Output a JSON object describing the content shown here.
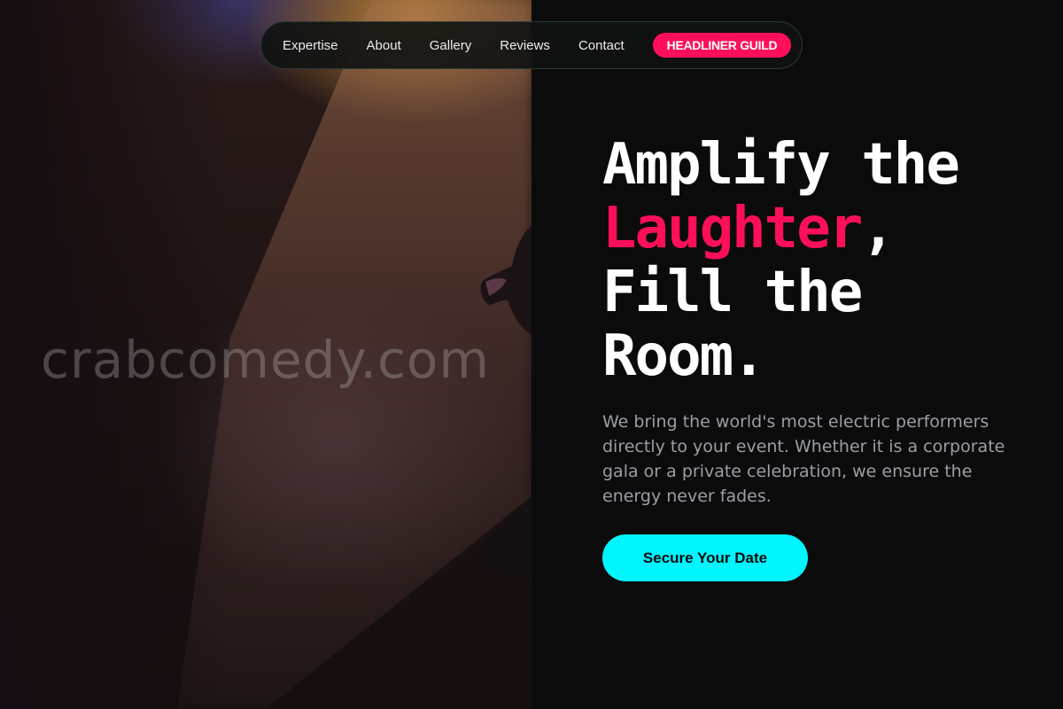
{
  "watermark": "crabcomedy.com",
  "nav": {
    "links": [
      "Expertise",
      "About",
      "Gallery",
      "Reviews",
      "Contact"
    ],
    "cta_label": "HEADLINER GUILD"
  },
  "hero": {
    "heading_line1": "Amplify the",
    "heading_accent": "Laughter",
    "heading_comma": ",",
    "heading_line3": "Fill the",
    "heading_line4": "Room.",
    "description": "We bring the world's most electric performers directly to your event. Whether it is a corporate gala or a private celebration, we ensure the energy never fades.",
    "cta_label": "Secure Your Date"
  },
  "colors": {
    "accent_pink": "#ff0f5a",
    "accent_cyan": "#00f5ff",
    "background": "#0b0b0c"
  }
}
